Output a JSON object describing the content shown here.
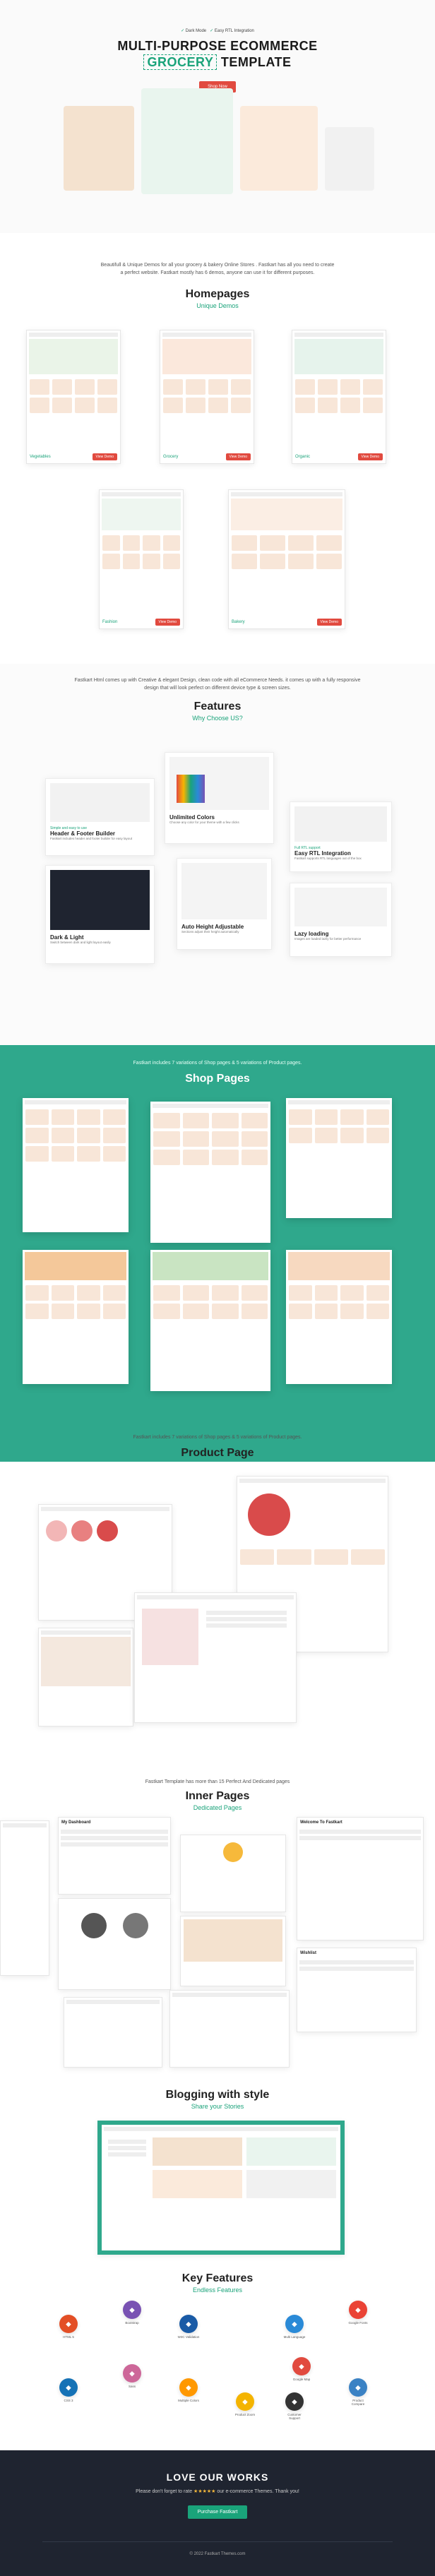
{
  "hero": {
    "tag1": "Dark Mode",
    "tag2": "Easy RTL Integration",
    "title_line1": "MULTI-PURPOSE ECOMMERCE",
    "title_word": "GROCERY",
    "title_rest": "TEMPLATE",
    "button": "Shop Now"
  },
  "intro": {
    "text": "Beautifull & Unique Demos for all your grocery & bakery Online Stores . Fastkart has all you need to create a perfect website. Fastkart mostly has 6 demos, anyone can use it for different purposes."
  },
  "homepages": {
    "title": "Homepages",
    "subtitle": "Unique Demos",
    "items": [
      {
        "label": "Vegetables",
        "button": "View Demo"
      },
      {
        "label": "Grocery",
        "button": "View Demo"
      },
      {
        "label": "Organic",
        "button": "View Demo"
      },
      {
        "label": "Fashion",
        "button": "View Demo"
      },
      {
        "label": "Bakery",
        "button": "View Demo"
      }
    ]
  },
  "features": {
    "intro": "Fastkart Html comes up with Creative & elegant Design, clean code with all eCommerce Needs. it comes up with a fully responsive design that will look perfect on different device type & screen sizes.",
    "title": "Features",
    "subtitle": "Why Choose US?",
    "items": [
      {
        "subtitle": "Simple and easy to use",
        "title": "Header & Footer Builder",
        "desc": "Fastkart includes header and footer builder for easy layout"
      },
      {
        "subtitle": "Customizable",
        "title": "Unlimited Colors",
        "desc": "Choose any color for your theme with a few clicks"
      },
      {
        "subtitle": "Full RTL support",
        "title": "Easy RTL Integration",
        "desc": "Fastkart supports RTL languages out of the box"
      },
      {
        "subtitle": "Dark layout",
        "title": "Dark & Light",
        "desc": "Switch between dark and light layout easily"
      },
      {
        "subtitle": "Auto height",
        "title": "Auto Height Adjustable",
        "desc": "Sections adjust their height automatically"
      },
      {
        "subtitle": "Fast loading",
        "title": "Lazy loading",
        "desc": "Images are loaded lazily for better performance"
      }
    ]
  },
  "shop": {
    "intro": "Fastkart includes 7 variations of Shop pages & 5 variations of Product pages.",
    "title": "Shop Pages"
  },
  "product": {
    "intro": "Fastkart includes 7 variations of Shop pages & 5 variations of Product pages.",
    "title": "Product Page"
  },
  "inner": {
    "intro": "Fastkart Template has more than 15 Perfect And Dedicated pages",
    "title": "Inner Pages",
    "subtitle": "Dedicated Pages",
    "dashboard": "My Dashboard",
    "welcome": "Welcome To Fastkart",
    "wishlist": "Wishlist"
  },
  "blog": {
    "title": "Blogging with style",
    "subtitle": "Share your Stories"
  },
  "key": {
    "title": "Key Features",
    "subtitle": "Endless Features",
    "items": [
      {
        "name": "HTML 5",
        "icon": "html5-icon",
        "color": "#e34f26"
      },
      {
        "name": "Bootstrap",
        "icon": "bootstrap-icon",
        "color": "#7952b3"
      },
      {
        "name": "W3C Validation",
        "icon": "w3c-icon",
        "color": "#1a5ba6"
      },
      {
        "name": "Multi Language",
        "icon": "globe-icon",
        "color": "#2a8ad7"
      },
      {
        "name": "Google Fonts",
        "icon": "fonts-icon",
        "color": "#ea4335"
      },
      {
        "name": "Sass",
        "icon": "sass-icon",
        "color": "#cd6799"
      },
      {
        "name": "Multiple Colors",
        "icon": "colors-icon",
        "color": "#ff9800"
      },
      {
        "name": "CSS 3",
        "icon": "css3-icon",
        "color": "#1572b6"
      },
      {
        "name": "Google Map",
        "icon": "map-icon",
        "color": "#e14a3f"
      },
      {
        "name": "Customer Support",
        "icon": "support-icon",
        "color": "#333333"
      },
      {
        "name": "Product Compare",
        "icon": "compare-icon",
        "color": "#3b82c4"
      },
      {
        "name": "Product Zoom",
        "icon": "zoom-icon",
        "color": "#f4b400"
      }
    ]
  },
  "footer": {
    "title": "LOVE OUR WORKS",
    "text_before": "Please don't forget to rate",
    "stars": "★★★★★",
    "text_after": "our e-commerce Themes. Thank you!",
    "button": "Purchase Fastkart",
    "copyright": "© 2022 Fastkart Themes.com"
  }
}
